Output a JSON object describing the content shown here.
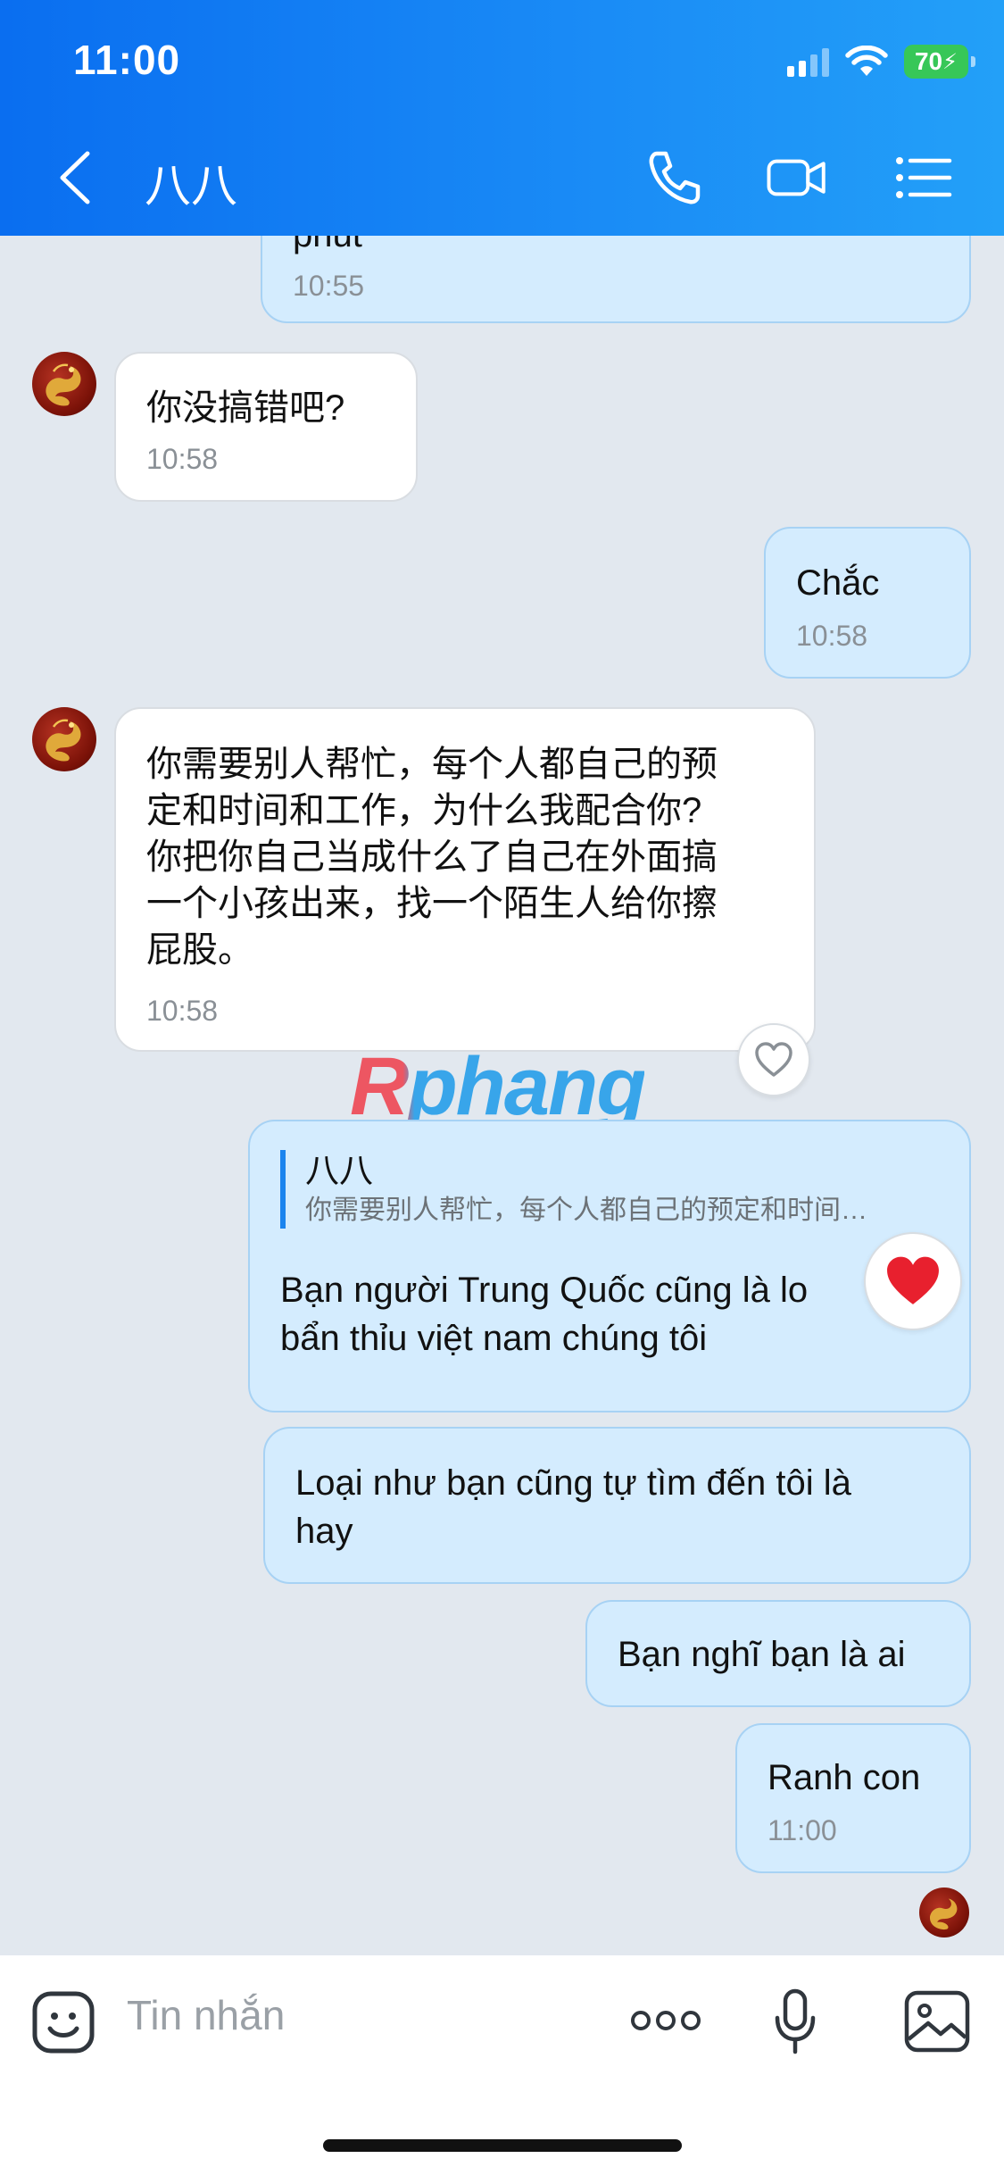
{
  "status_bar": {
    "time": "11:00",
    "battery": "70"
  },
  "header": {
    "title": "八八"
  },
  "messages": [
    {
      "partial_text": "phút",
      "time": "10:55"
    },
    {
      "text": "你没搞错吧?",
      "time": "10:58"
    },
    {
      "text": "Chắc",
      "time": "10:58"
    },
    {
      "lines": [
        "你需要别人帮忙，每个人都自己的预",
        "定和时间和工作，为什么我配合你?",
        "你把你自己当成什么了自己在外面搞",
        "一个小孩出来，找一个陌生人给你擦",
        "屁股。"
      ],
      "time": "10:58"
    },
    {
      "quote_name": "八八",
      "quote_text": "你需要别人帮忙，每个人都自己的预定和时间…",
      "lines": [
        "Bạn người Trung Quốc cũng là lo",
        "bẩn thỉu việt nam chúng tôi"
      ]
    },
    {
      "lines": [
        "Loại như bạn cũng tự tìm đến tôi là",
        "hay"
      ]
    },
    {
      "text": "Bạn nghĩ bạn là ai"
    },
    {
      "text": "Ranh con",
      "time": "11:00"
    }
  ],
  "watermark": "Rphang",
  "input": {
    "placeholder": "Tin nhắn"
  },
  "icons": {
    "header": [
      "back-icon",
      "phone-icon",
      "video-icon",
      "menu-icon"
    ],
    "input_bar": [
      "sticker-icon",
      "more-icon",
      "mic-icon",
      "image-icon"
    ],
    "reactions": [
      "heart-outline-icon",
      "heart-filled-icon"
    ]
  },
  "colors": {
    "header_start": "#0a6ef0",
    "header_end": "#23a0f8",
    "outgoing_bubble": "#d4ecfe",
    "incoming_bubble": "#ffffff",
    "background": "#e2e8ef",
    "heart": "#e8202e"
  }
}
